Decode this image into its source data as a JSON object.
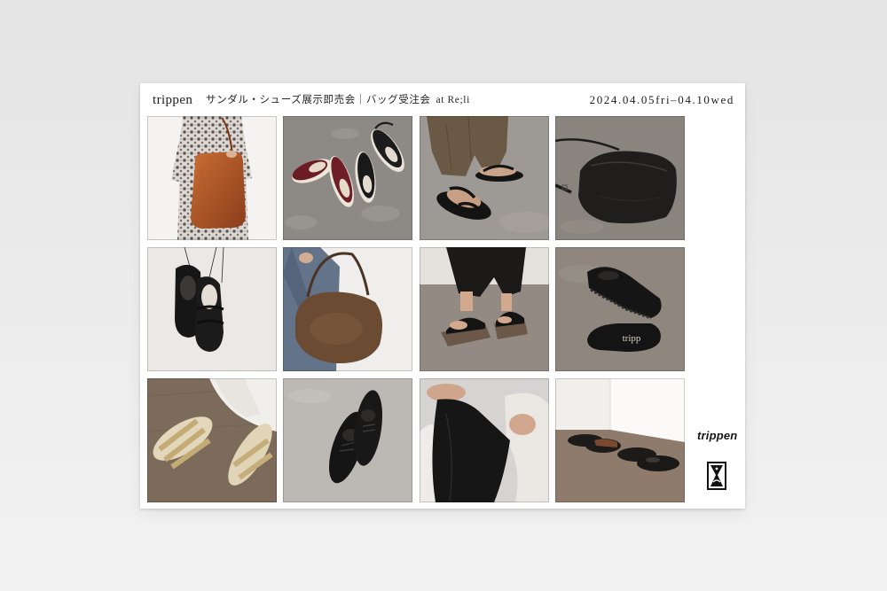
{
  "header": {
    "brand": "trippen",
    "event": "サンダル・シューズ展示即売会｜バッグ受注会",
    "venue": "at Re;li",
    "dates": "2024.04.05fri–04.10wed"
  },
  "footer": {
    "brand": "trippen",
    "stamp_icon": "hourglass-stamp-icon"
  },
  "photo_lettering": {
    "sole_mark": "tripp"
  },
  "colors": {
    "backdrop": "#ebebeb",
    "card": "#ffffff",
    "ink": "#1e1e1e"
  }
}
